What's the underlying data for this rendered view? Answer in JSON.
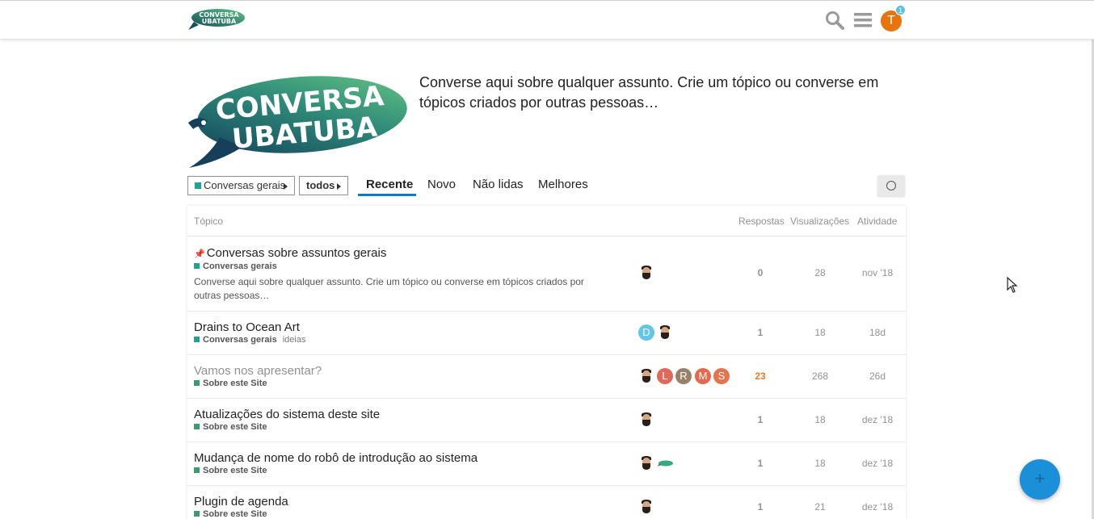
{
  "header": {
    "avatar_letter": "T",
    "notification_count": "1",
    "accent_color": "#e8740e"
  },
  "logo": {
    "line1": "CONVERSA",
    "line2": "UBATUBA"
  },
  "banner": {
    "text": "Converse aqui sobre qualquer assunto. Crie um tópico ou converse em tópicos criados por outras pessoas…"
  },
  "nav": {
    "category_dropdown": "Conversas gerais",
    "tag_dropdown": "todos",
    "tabs": [
      {
        "label": "Recente",
        "active": true
      },
      {
        "label": "Novo",
        "active": false
      },
      {
        "label": "Não lidas",
        "active": false
      },
      {
        "label": "Melhores",
        "active": false
      }
    ]
  },
  "table": {
    "columns": {
      "topic": "Tópico",
      "replies": "Respostas",
      "views": "Visualizações",
      "activity": "Atividade"
    },
    "rows": [
      {
        "title": "Conversas sobre assuntos gerais",
        "pinned": true,
        "category": "Conversas gerais",
        "category_color": "#1ea48e",
        "tag": "",
        "excerpt": "Converse aqui sobre qualquer assunto. Crie um tópico ou converse em tópicos criados por outras pessoas…",
        "replies": "0",
        "views": "28",
        "activity": "nov '18"
      },
      {
        "title": "Drains to Ocean Art",
        "pinned": false,
        "category": "Conversas gerais",
        "category_color": "#1ea48e",
        "tag": "ideias",
        "posters": [
          "D"
        ],
        "replies": "1",
        "views": "18",
        "activity": "18d"
      },
      {
        "title": "Vamos nos apresentar?",
        "pinned": false,
        "visited": true,
        "category": "Sobre este Site",
        "category_color": "#3a9b73",
        "tag": "",
        "posters": [
          "L",
          "R",
          "M",
          "S"
        ],
        "replies": "23",
        "views": "268",
        "activity": "26d"
      },
      {
        "title": "Atualizações do sistema deste site",
        "pinned": false,
        "category": "Sobre este Site",
        "category_color": "#3a9b73",
        "tag": "",
        "replies": "1",
        "views": "18",
        "activity": "dez '18"
      },
      {
        "title": "Mudança de nome do robô de introdução ao sistema",
        "pinned": false,
        "category": "Sobre este Site",
        "category_color": "#3a9b73",
        "tag": "",
        "replies": "1",
        "views": "18",
        "activity": "dez '18"
      },
      {
        "title": "Plugin de agenda",
        "pinned": false,
        "category": "Sobre este Site",
        "category_color": "#3a9b73",
        "tag": "",
        "replies": "1",
        "views": "21",
        "activity": "dez '18"
      }
    ]
  },
  "fab": {
    "icon": "plus-icon",
    "color": "#1b8fd8"
  }
}
